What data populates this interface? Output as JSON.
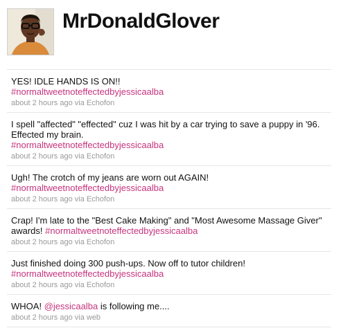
{
  "profile": {
    "username": "MrDonaldGlover",
    "avatar_icon": "profile-photo"
  },
  "colors": {
    "hashtag": "#c6337e",
    "meta": "#999999",
    "divider": "#e6e6e6"
  },
  "tweets": [
    {
      "text": "YES! IDLE HANDS IS ON!!",
      "hashtag": "#normaltweetnoteffectedbyjessicaalba",
      "time": "about 2 hours ago",
      "via_prefix": "via",
      "source": "Echofon"
    },
    {
      "text": "I spell \"affected\" \"effected\" cuz I was hit by a car trying to save a puppy in '96. Effected my brain.",
      "hashtag": "#normaltweetnoteffectedbyjessicaalba",
      "time": "about 2 hours ago",
      "via_prefix": "via",
      "source": "Echofon"
    },
    {
      "text": "Ugh! The crotch of my jeans are worn out AGAIN!",
      "hashtag": "#normaltweetnoteffectedbyjessicaalba",
      "time": "about 2 hours ago",
      "via_prefix": "via",
      "source": "Echofon"
    },
    {
      "text": "Crap! I'm late to the \"Best Cake Making\" and \"Most Awesome Massage Giver\" awards!",
      "hashtag": "#normaltweetnoteffectedbyjessicaalba",
      "time": "about 2 hours ago",
      "via_prefix": "via",
      "source": "Echofon"
    },
    {
      "text": "Just finished doing 300 push-ups. Now off to tutor children!",
      "hashtag": "#normaltweetnoteffectedbyjessicaalba",
      "time": "about 2 hours ago",
      "via_prefix": "via",
      "source": "Echofon"
    },
    {
      "text_before": "WHOA!",
      "mention": "@jessicaalba",
      "text_after": "is following me....",
      "time": "about 2 hours ago",
      "via_prefix": "via",
      "source": "web"
    }
  ]
}
